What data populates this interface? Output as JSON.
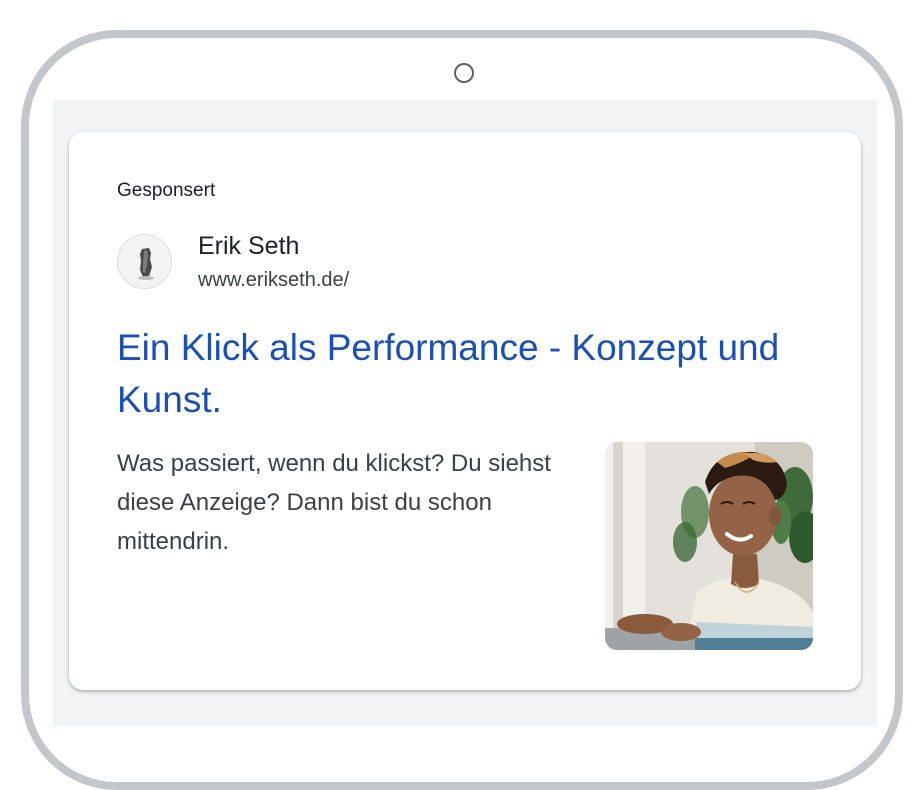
{
  "ad": {
    "sponsored_label": "Gesponsert",
    "advertiser": {
      "name": "Erik Seth",
      "url": "www.erikseth.de/",
      "avatar_icon": "sculpture-photo"
    },
    "headline": "Ein Klick als Performance - Konzept und Kunst.",
    "description": "Was passiert, wenn du klickst? Du siehst diese Anzeige? Dann bist du schon mittendrin.",
    "image_icon": "person-smiling-at-laptop-photo"
  },
  "colors": {
    "headline": "#1a4fb8",
    "frame": "#c3c7cc",
    "screen_background": "#f1f3f4",
    "card_background": "#ffffff"
  }
}
